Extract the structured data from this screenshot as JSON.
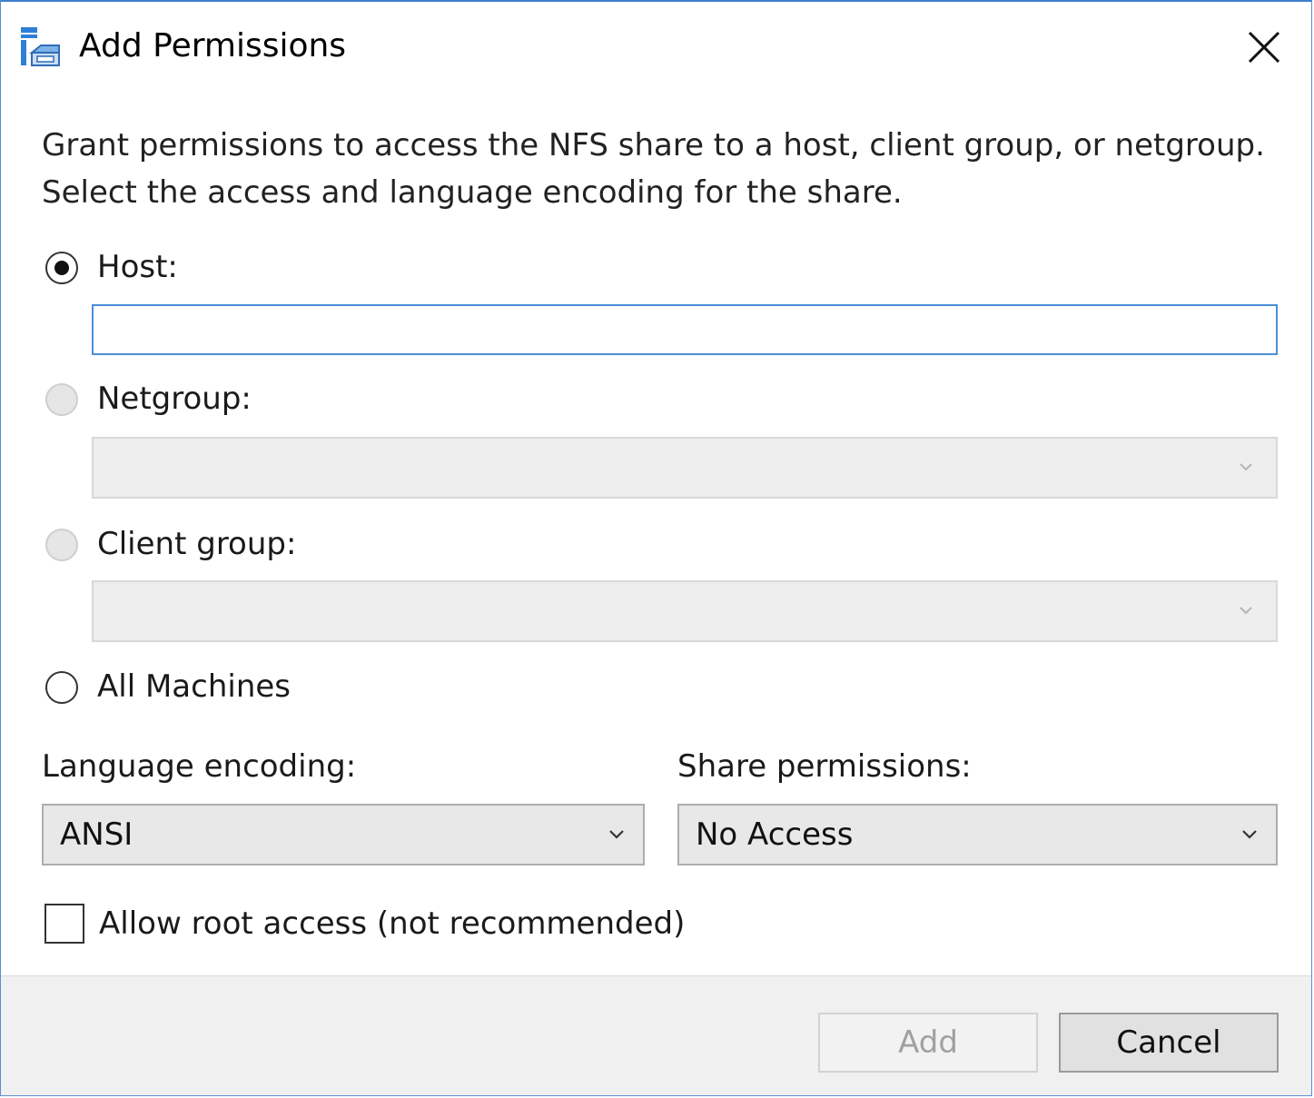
{
  "window": {
    "title": "Add Permissions",
    "icon": "nfs-share-icon",
    "close_icon": "close-icon"
  },
  "instructions": {
    "line1": "Grant permissions to access the NFS share to a host, client group, or netgroup.",
    "line2": "Select the access and language encoding for the share."
  },
  "target": {
    "host": {
      "label": "Host:",
      "selected": true,
      "value": ""
    },
    "netgroup": {
      "label": "Netgroup:",
      "selected": false,
      "enabled": false,
      "value": ""
    },
    "client_group": {
      "label": "Client group:",
      "selected": false,
      "enabled": false,
      "value": ""
    },
    "all_machines": {
      "label": "All Machines",
      "selected": false
    }
  },
  "language_encoding": {
    "label": "Language encoding:",
    "value": "ANSI"
  },
  "share_permissions": {
    "label": "Share permissions:",
    "value": "No Access"
  },
  "root_access": {
    "label": "Allow root access (not recommended)",
    "checked": false
  },
  "buttons": {
    "add": "Add",
    "add_enabled": false,
    "cancel": "Cancel"
  },
  "colors": {
    "focus_border": "#4a8fd8",
    "window_border": "#3c7fd0",
    "footer_bg": "#f0f0f0"
  }
}
